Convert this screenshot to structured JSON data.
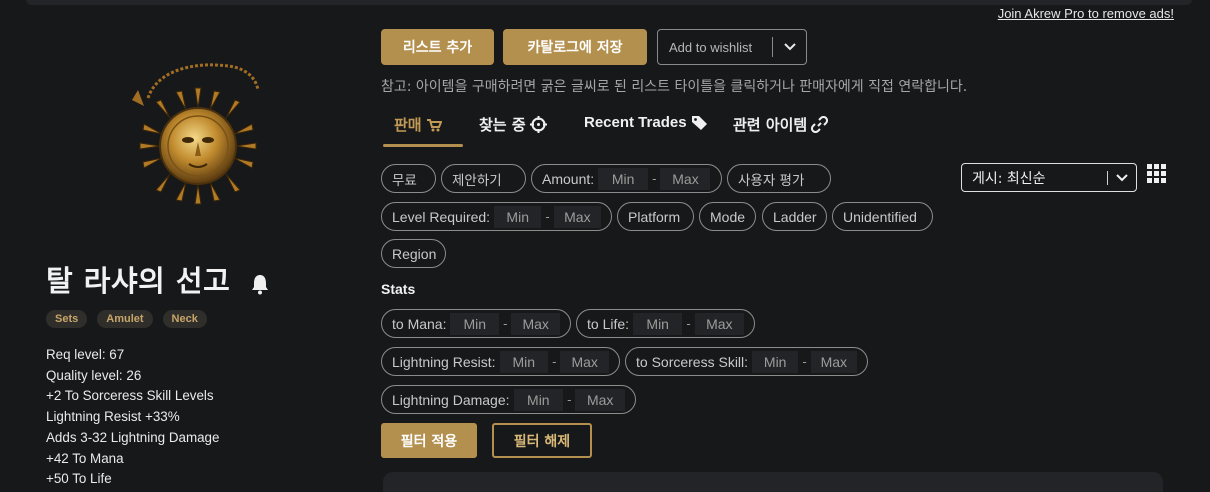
{
  "ad_link": "Join Akrew Pro to remove ads!",
  "item": {
    "title": "탈 라샤의 선고",
    "tags": [
      "Sets",
      "Amulet",
      "Neck"
    ],
    "properties": [
      "Req level: 67",
      "Quality level: 26",
      "+2 To Sorceress Skill Levels",
      "Lightning Resist +33%",
      "Adds 3-32 Lightning Damage",
      "+42 To Mana",
      "+50 To Life"
    ]
  },
  "actions": {
    "add_list": "리스트 추가",
    "save_catalog": "카탈로그에 저장",
    "wishlist": "Add to wishlist"
  },
  "note": "참고: 아이템을 구매하려면 굵은 글씨로 된 리스트 타이틀을 클릭하거나 판매자에게 직접 연락합니다.",
  "tabs": [
    {
      "label": "판매",
      "icon": "cart-icon"
    },
    {
      "label": "찾는 중",
      "icon": "crosshair-icon"
    },
    {
      "label": "Recent Trades",
      "icon": "tag-icon"
    },
    {
      "label": "관련 아이템",
      "icon": "link-icon"
    }
  ],
  "filters": {
    "free": "무료",
    "offer": "제안하기",
    "amount": "Amount:",
    "user_rating": "사용자 평가",
    "level_required": "Level Required:",
    "platform": "Platform",
    "mode": "Mode",
    "ladder": "Ladder",
    "unidentified": "Unidentified",
    "region": "Region",
    "min": "Min",
    "max": "Max",
    "dash": "-"
  },
  "sort": {
    "selected": "게시: 최신순"
  },
  "stats": {
    "heading": "Stats",
    "fields": [
      "to Mana:",
      "to Life:",
      "Lightning Resist:",
      "to Sorceress Skill:",
      "Lightning Damage:"
    ]
  },
  "buttons": {
    "apply": "필터 적용",
    "reset": "필터 해제"
  },
  "colors": {
    "accent": "#b4904f",
    "background": "#17181a",
    "pill_border": "#8c8c8c"
  }
}
